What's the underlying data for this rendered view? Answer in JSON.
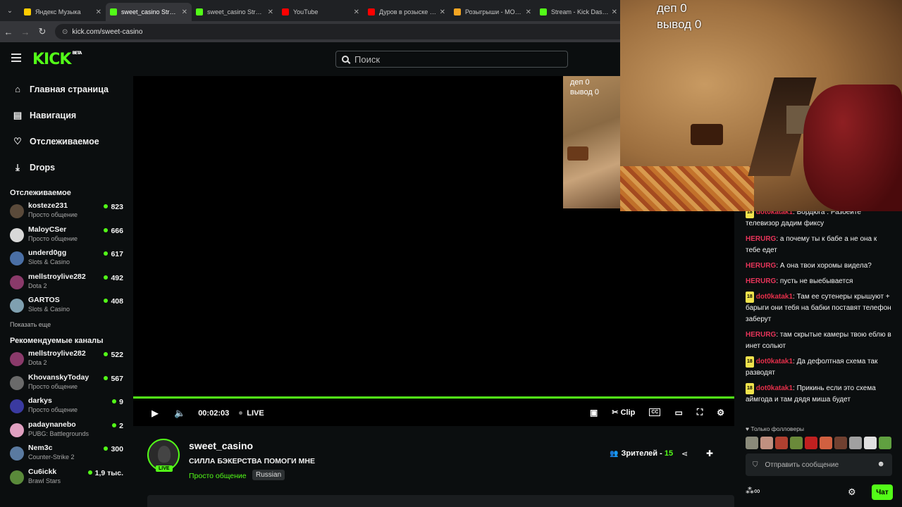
{
  "browser": {
    "tabs": [
      {
        "title": "Яндекс Музыка",
        "icon": "yandex-music-icon",
        "color": "#ffcc00",
        "active": false
      },
      {
        "title": "sweet_casino Stream",
        "icon": "kick-icon",
        "color": "#53fc18",
        "active": true
      },
      {
        "title": "sweet_casino Stream",
        "icon": "kick-icon",
        "color": "#53fc18",
        "active": false
      },
      {
        "title": "YouTube",
        "icon": "youtube-icon",
        "color": "#ff0000",
        "active": false
      },
      {
        "title": "Дуров в розыске // Г",
        "icon": "youtube-icon",
        "color": "#ff0000",
        "active": false
      },
      {
        "title": "Розыгрыши - MONE",
        "icon": "giveaway-icon",
        "color": "#f5a623",
        "active": false
      },
      {
        "title": "Stream - Kick Dashbo",
        "icon": "kick-icon",
        "color": "#53fc18",
        "active": false
      }
    ],
    "url": "kick.com/sweet-casino"
  },
  "header": {
    "logo": "KICK",
    "logo_beta": "BETA",
    "search_placeholder": "Поиск"
  },
  "sidebar": {
    "nav": [
      {
        "label": "Главная страница",
        "icon": "home-icon"
      },
      {
        "label": "Навигация",
        "icon": "browse-icon"
      },
      {
        "label": "Отслеживаемое",
        "icon": "heart-icon"
      },
      {
        "label": "Drops",
        "icon": "drops-icon"
      }
    ],
    "following_title": "Отслеживаемое",
    "following": [
      {
        "name": "kosteze231",
        "category": "Просто общение",
        "viewers": "823",
        "avatar_color": "#5a4a3a"
      },
      {
        "name": "MaloyCSer",
        "category": "Просто общение",
        "viewers": "666",
        "avatar_color": "#d8d8d8"
      },
      {
        "name": "underd0gg",
        "category": "Slots & Casino",
        "viewers": "617",
        "avatar_color": "#4a6fa5"
      },
      {
        "name": "mellstroylive282",
        "category": "Dota 2",
        "viewers": "492",
        "avatar_color": "#8a3a6a"
      },
      {
        "name": "GARTOS",
        "category": "Slots & Casino",
        "viewers": "408",
        "avatar_color": "#7fa0b0"
      }
    ],
    "show_more": "Показать еще",
    "recommended_title": "Рекомендуемые каналы",
    "recommended": [
      {
        "name": "mellstroylive282",
        "category": "Dota 2",
        "viewers": "522",
        "avatar_color": "#8a3a6a"
      },
      {
        "name": "KhovanskyToday",
        "category": "Просто общение",
        "viewers": "567",
        "avatar_color": "#6a6a6a"
      },
      {
        "name": "darkys",
        "category": "Просто общение",
        "viewers": "9",
        "avatar_color": "#3a3aa0"
      },
      {
        "name": "padaynanebo",
        "category": "PUBG: Battlegrounds",
        "viewers": "2",
        "avatar_color": "#e0a0c0"
      },
      {
        "name": "Nem3c",
        "category": "Counter-Strike 2",
        "viewers": "300",
        "avatar_color": "#5a7aa0"
      },
      {
        "name": "Cu6ickk",
        "category": "Brawl Stars",
        "viewers": "1,9 тыс.",
        "avatar_color": "#5a8a3a"
      }
    ]
  },
  "player": {
    "thumb_overlay_line1": "деп 0",
    "thumb_overlay_line2": "вывод 0",
    "time": "00:02:03",
    "live_label": "LIVE",
    "clip_label": "Clip",
    "cc_label": "CC",
    "progress_fraction": 1.0
  },
  "stream": {
    "streamer": "sweet_casino",
    "live_badge": "LIVE",
    "title": "СИЛЛА БЭКЕРСТВА ПОМОГИ МНЕ",
    "category": "Просто общение",
    "tag": "Russian",
    "viewers_label": "Зрителей - ",
    "viewers_count": "15"
  },
  "webcam": {
    "overlay_line1": "деп 0",
    "overlay_line2": "вывод 0"
  },
  "chat": {
    "messages": [
      {
        "user": "dot0katak1",
        "badge": "18",
        "user_color": "#e62f4a",
        "text": "Вордюга . Разбейте телевизор дадим фиксу"
      },
      {
        "user": "HERURG",
        "badge": "",
        "user_color": "#e8355a",
        "text": "а почему ты к бабе а не она к тебе едет"
      },
      {
        "user": "HERURG",
        "badge": "",
        "user_color": "#e8355a",
        "text": "А она твои хоромы видела?"
      },
      {
        "user": "HERURG",
        "badge": "",
        "user_color": "#e8355a",
        "text": "пусть не выебывается"
      },
      {
        "user": "dot0katak1",
        "badge": "18",
        "user_color": "#e62f4a",
        "text": "Там ее сутенеры крышуют + барыги они тебя на бабки поставят телефон заберут"
      },
      {
        "user": "HERURG",
        "badge": "",
        "user_color": "#e8355a",
        "text": "там скрытые камеры твою еблю в инет сольют"
      },
      {
        "user": "dot0katak1",
        "badge": "18",
        "user_color": "#e62f4a",
        "text": "Да дефолтная схема так разводят"
      },
      {
        "user": "dot0katak1",
        "badge": "18",
        "user_color": "#e62f4a",
        "text": "Прикинь если это схема аймгода и там дядя миша будет"
      }
    ],
    "followers_only": "Только фолловеры",
    "emote_colors": [
      "#8a8a7a",
      "#c09080",
      "#b04030",
      "#6a8a3a",
      "#c02020",
      "#d06040",
      "#704030",
      "#a0a0a0",
      "#e0e0e0",
      "#60a040"
    ],
    "input_placeholder": "Отправить сообщение",
    "chat_button": "Чат"
  }
}
